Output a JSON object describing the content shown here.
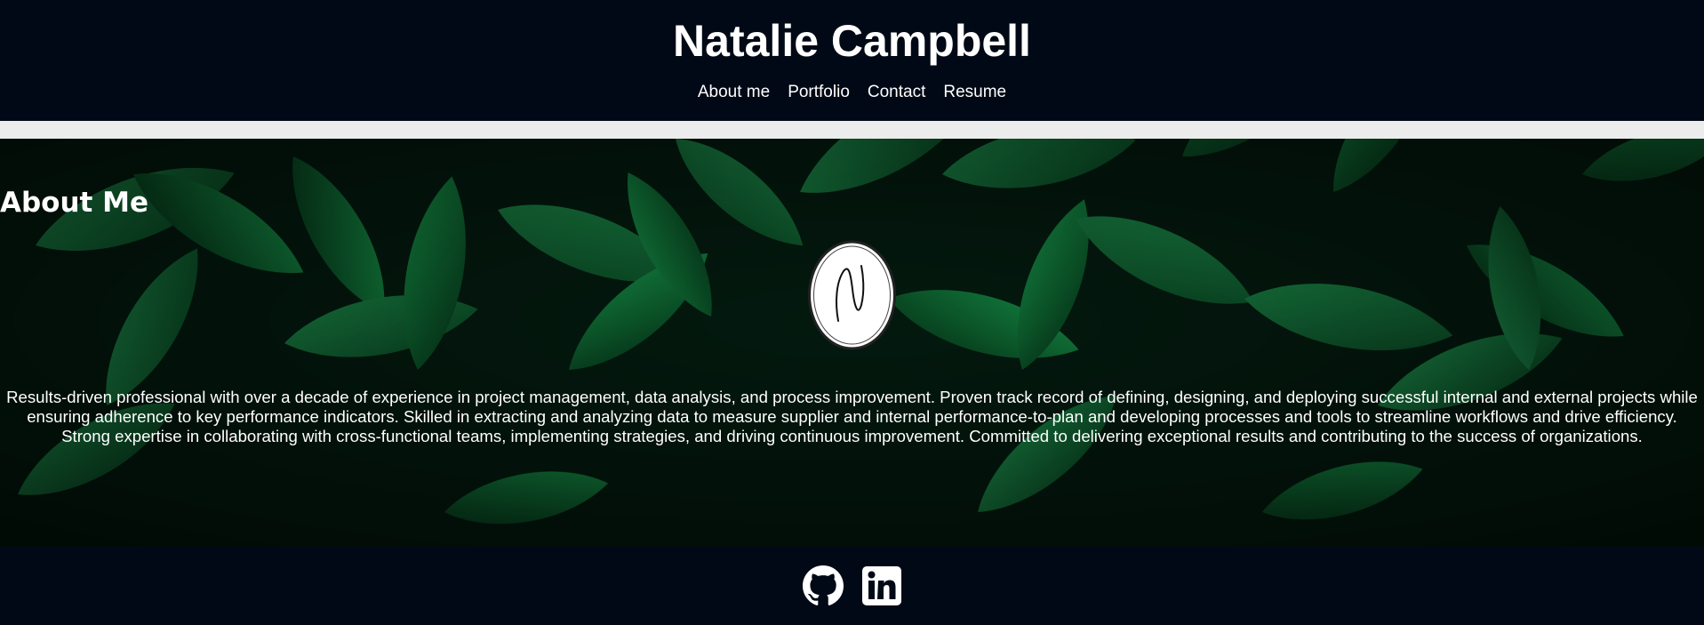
{
  "header": {
    "title": "Natalie Campbell",
    "nav": [
      {
        "label": "About me"
      },
      {
        "label": "Portfolio"
      },
      {
        "label": "Contact"
      },
      {
        "label": "Resume"
      }
    ]
  },
  "about": {
    "heading": "About Me",
    "avatar_letter": "N",
    "text": "Results-driven professional with over a decade of experience in project management, data analysis, and process improvement. Proven track record of defining, designing, and deploying successful internal and external projects while ensuring adherence to key performance indicators. Skilled in extracting and analyzing data to measure supplier and internal performance-to-plan and developing processes and tools to streamline workflows and drive efficiency. Strong expertise in collaborating with cross-functional teams, implementing strategies, and driving continuous improvement. Committed to delivering exceptional results and contributing to the success of organizations."
  },
  "footer": {
    "icons": [
      "github-icon",
      "linkedin-icon"
    ]
  },
  "colors": {
    "header_bg": "#020916",
    "divider": "#ececec",
    "text": "#ffffff",
    "leaf_green": "#0f6b38"
  }
}
